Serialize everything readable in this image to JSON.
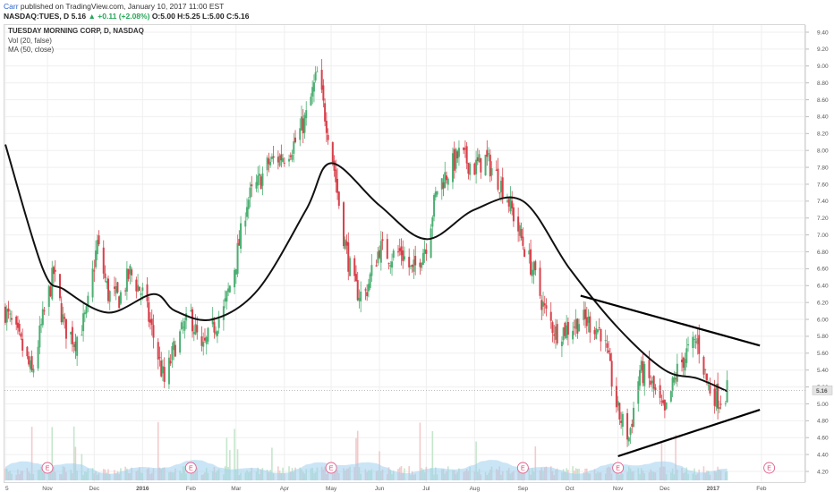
{
  "header": {
    "author": "Carr",
    "published_text": "published on TradingView.com, January 10, 2017 11:00 EST",
    "symbol": "NASDAQ:TUES, D",
    "last": "5.16",
    "change": "+0.11 (+2.08%)",
    "ohlc": "O:5.00 H:5.25 L:5.00 C:5.16"
  },
  "legend": {
    "title": "TUESDAY MORNING CORP, D, NASDAQ",
    "vol": "Vol (20, false)",
    "ma": "MA (50, close)"
  },
  "price_axis": {
    "ticks": [
      "9.40",
      "9.20",
      "9.00",
      "8.80",
      "8.60",
      "8.40",
      "8.20",
      "8.00",
      "7.80",
      "7.60",
      "7.40",
      "7.20",
      "7.00",
      "6.80",
      "6.60",
      "6.40",
      "6.20",
      "6.00",
      "5.80",
      "5.60",
      "5.40",
      "5.20",
      "5.00",
      "4.80",
      "4.60",
      "4.40",
      "4.20"
    ],
    "last_price_label": "5.16"
  },
  "time_axis": {
    "labels": [
      "5",
      "Nov",
      "Dec",
      "2016",
      "Feb",
      "Mar",
      "Apr",
      "May",
      "Jun",
      "Jul",
      "Aug",
      "Sep",
      "Oct",
      "Nov",
      "Dec",
      "2017",
      "Feb"
    ]
  },
  "earnings_marker": "E",
  "colors": {
    "up": "#4caf72",
    "down": "#d8404a",
    "ma": "#111111",
    "volume": "#9fd0ee",
    "last_price_bg": "#e4e4e4"
  },
  "chart_data": {
    "type": "candlestick",
    "ylim": [
      4.2,
      9.4
    ],
    "ma_label": "MA (50, close)",
    "price_path": [
      {
        "date": "2015-10-05",
        "close": 6.1
      },
      {
        "date": "2015-10-15",
        "close": 5.7
      },
      {
        "date": "2015-10-22",
        "close": 5.35
      },
      {
        "date": "2015-10-29",
        "close": 6.0
      },
      {
        "date": "2015-11-05",
        "close": 6.55
      },
      {
        "date": "2015-11-12",
        "close": 5.9
      },
      {
        "date": "2015-11-19",
        "close": 5.75
      },
      {
        "date": "2015-11-26",
        "close": 6.05
      },
      {
        "date": "2015-12-03",
        "close": 6.9
      },
      {
        "date": "2015-12-10",
        "close": 6.3
      },
      {
        "date": "2015-12-17",
        "close": 6.25
      },
      {
        "date": "2015-12-24",
        "close": 6.55
      },
      {
        "date": "2016-01-01",
        "close": 6.3
      },
      {
        "date": "2016-01-08",
        "close": 5.8
      },
      {
        "date": "2016-01-15",
        "close": 5.25
      },
      {
        "date": "2016-01-22",
        "close": 5.7
      },
      {
        "date": "2016-02-01",
        "close": 6.05
      },
      {
        "date": "2016-02-08",
        "close": 5.6
      },
      {
        "date": "2016-02-15",
        "close": 5.9
      },
      {
        "date": "2016-02-22",
        "close": 6.1
      },
      {
        "date": "2016-03-01",
        "close": 6.7
      },
      {
        "date": "2016-03-08",
        "close": 7.4
      },
      {
        "date": "2016-03-15",
        "close": 7.6
      },
      {
        "date": "2016-03-22",
        "close": 7.85
      },
      {
        "date": "2016-04-01",
        "close": 7.95
      },
      {
        "date": "2016-04-08",
        "close": 8.1
      },
      {
        "date": "2016-04-15",
        "close": 8.4
      },
      {
        "date": "2016-04-22",
        "close": 8.9
      },
      {
        "date": "2016-05-01",
        "close": 8.05
      },
      {
        "date": "2016-05-08",
        "close": 7.1
      },
      {
        "date": "2016-05-15",
        "close": 6.4
      },
      {
        "date": "2016-05-22",
        "close": 6.25
      },
      {
        "date": "2016-06-01",
        "close": 6.85
      },
      {
        "date": "2016-06-08",
        "close": 6.75
      },
      {
        "date": "2016-06-15",
        "close": 6.8
      },
      {
        "date": "2016-06-22",
        "close": 6.55
      },
      {
        "date": "2016-07-01",
        "close": 6.9
      },
      {
        "date": "2016-07-08",
        "close": 7.55
      },
      {
        "date": "2016-07-15",
        "close": 7.75
      },
      {
        "date": "2016-07-22",
        "close": 7.95
      },
      {
        "date": "2016-08-01",
        "close": 7.8
      },
      {
        "date": "2016-08-08",
        "close": 7.9
      },
      {
        "date": "2016-08-15",
        "close": 7.7
      },
      {
        "date": "2016-08-22",
        "close": 7.45
      },
      {
        "date": "2016-09-01",
        "close": 6.9
      },
      {
        "date": "2016-09-08",
        "close": 6.55
      },
      {
        "date": "2016-09-15",
        "close": 6.1
      },
      {
        "date": "2016-09-22",
        "close": 5.85
      },
      {
        "date": "2016-10-01",
        "close": 5.9
      },
      {
        "date": "2016-10-08",
        "close": 6.0
      },
      {
        "date": "2016-10-15",
        "close": 5.95
      },
      {
        "date": "2016-10-22",
        "close": 5.85
      },
      {
        "date": "2016-11-01",
        "close": 4.9
      },
      {
        "date": "2016-11-08",
        "close": 4.6
      },
      {
        "date": "2016-11-15",
        "close": 5.4
      },
      {
        "date": "2016-11-22",
        "close": 5.25
      },
      {
        "date": "2016-12-01",
        "close": 4.85
      },
      {
        "date": "2016-12-08",
        "close": 5.35
      },
      {
        "date": "2016-12-15",
        "close": 5.6
      },
      {
        "date": "2016-12-22",
        "close": 5.75
      },
      {
        "date": "2016-12-29",
        "close": 5.2
      },
      {
        "date": "2017-01-05",
        "close": 5.05
      },
      {
        "date": "2017-01-10",
        "close": 5.16
      }
    ],
    "ma_path": [
      {
        "date": "2015-10-05",
        "value": 8.07
      },
      {
        "date": "2015-10-29",
        "value": 6.6
      },
      {
        "date": "2015-11-12",
        "value": 6.35
      },
      {
        "date": "2015-12-10",
        "value": 6.08
      },
      {
        "date": "2016-01-08",
        "value": 6.3
      },
      {
        "date": "2016-01-22",
        "value": 6.1
      },
      {
        "date": "2016-02-15",
        "value": 6.0
      },
      {
        "date": "2016-03-15",
        "value": 6.35
      },
      {
        "date": "2016-04-15",
        "value": 7.3
      },
      {
        "date": "2016-05-01",
        "value": 7.85
      },
      {
        "date": "2016-06-01",
        "value": 7.35
      },
      {
        "date": "2016-07-01",
        "value": 6.95
      },
      {
        "date": "2016-08-01",
        "value": 7.3
      },
      {
        "date": "2016-09-01",
        "value": 7.4
      },
      {
        "date": "2016-10-01",
        "value": 6.6
      },
      {
        "date": "2016-11-01",
        "value": 5.9
      },
      {
        "date": "2016-12-01",
        "value": 5.4
      },
      {
        "date": "2016-12-22",
        "value": 5.3
      },
      {
        "date": "2017-01-10",
        "value": 5.15
      }
    ],
    "trendlines": [
      {
        "label": "upper",
        "from": {
          "date": "2016-10-08",
          "price": 6.28
        },
        "to": {
          "date": "2017-01-31",
          "price": 5.69
        }
      },
      {
        "label": "lower",
        "from": {
          "date": "2016-11-01",
          "price": 4.38
        },
        "to": {
          "date": "2017-01-31",
          "price": 4.93
        }
      }
    ],
    "earnings_dates": [
      "2015-11-01",
      "2016-02-01",
      "2016-05-01",
      "2016-09-01",
      "2016-11-01",
      "2017-02-06"
    ]
  }
}
